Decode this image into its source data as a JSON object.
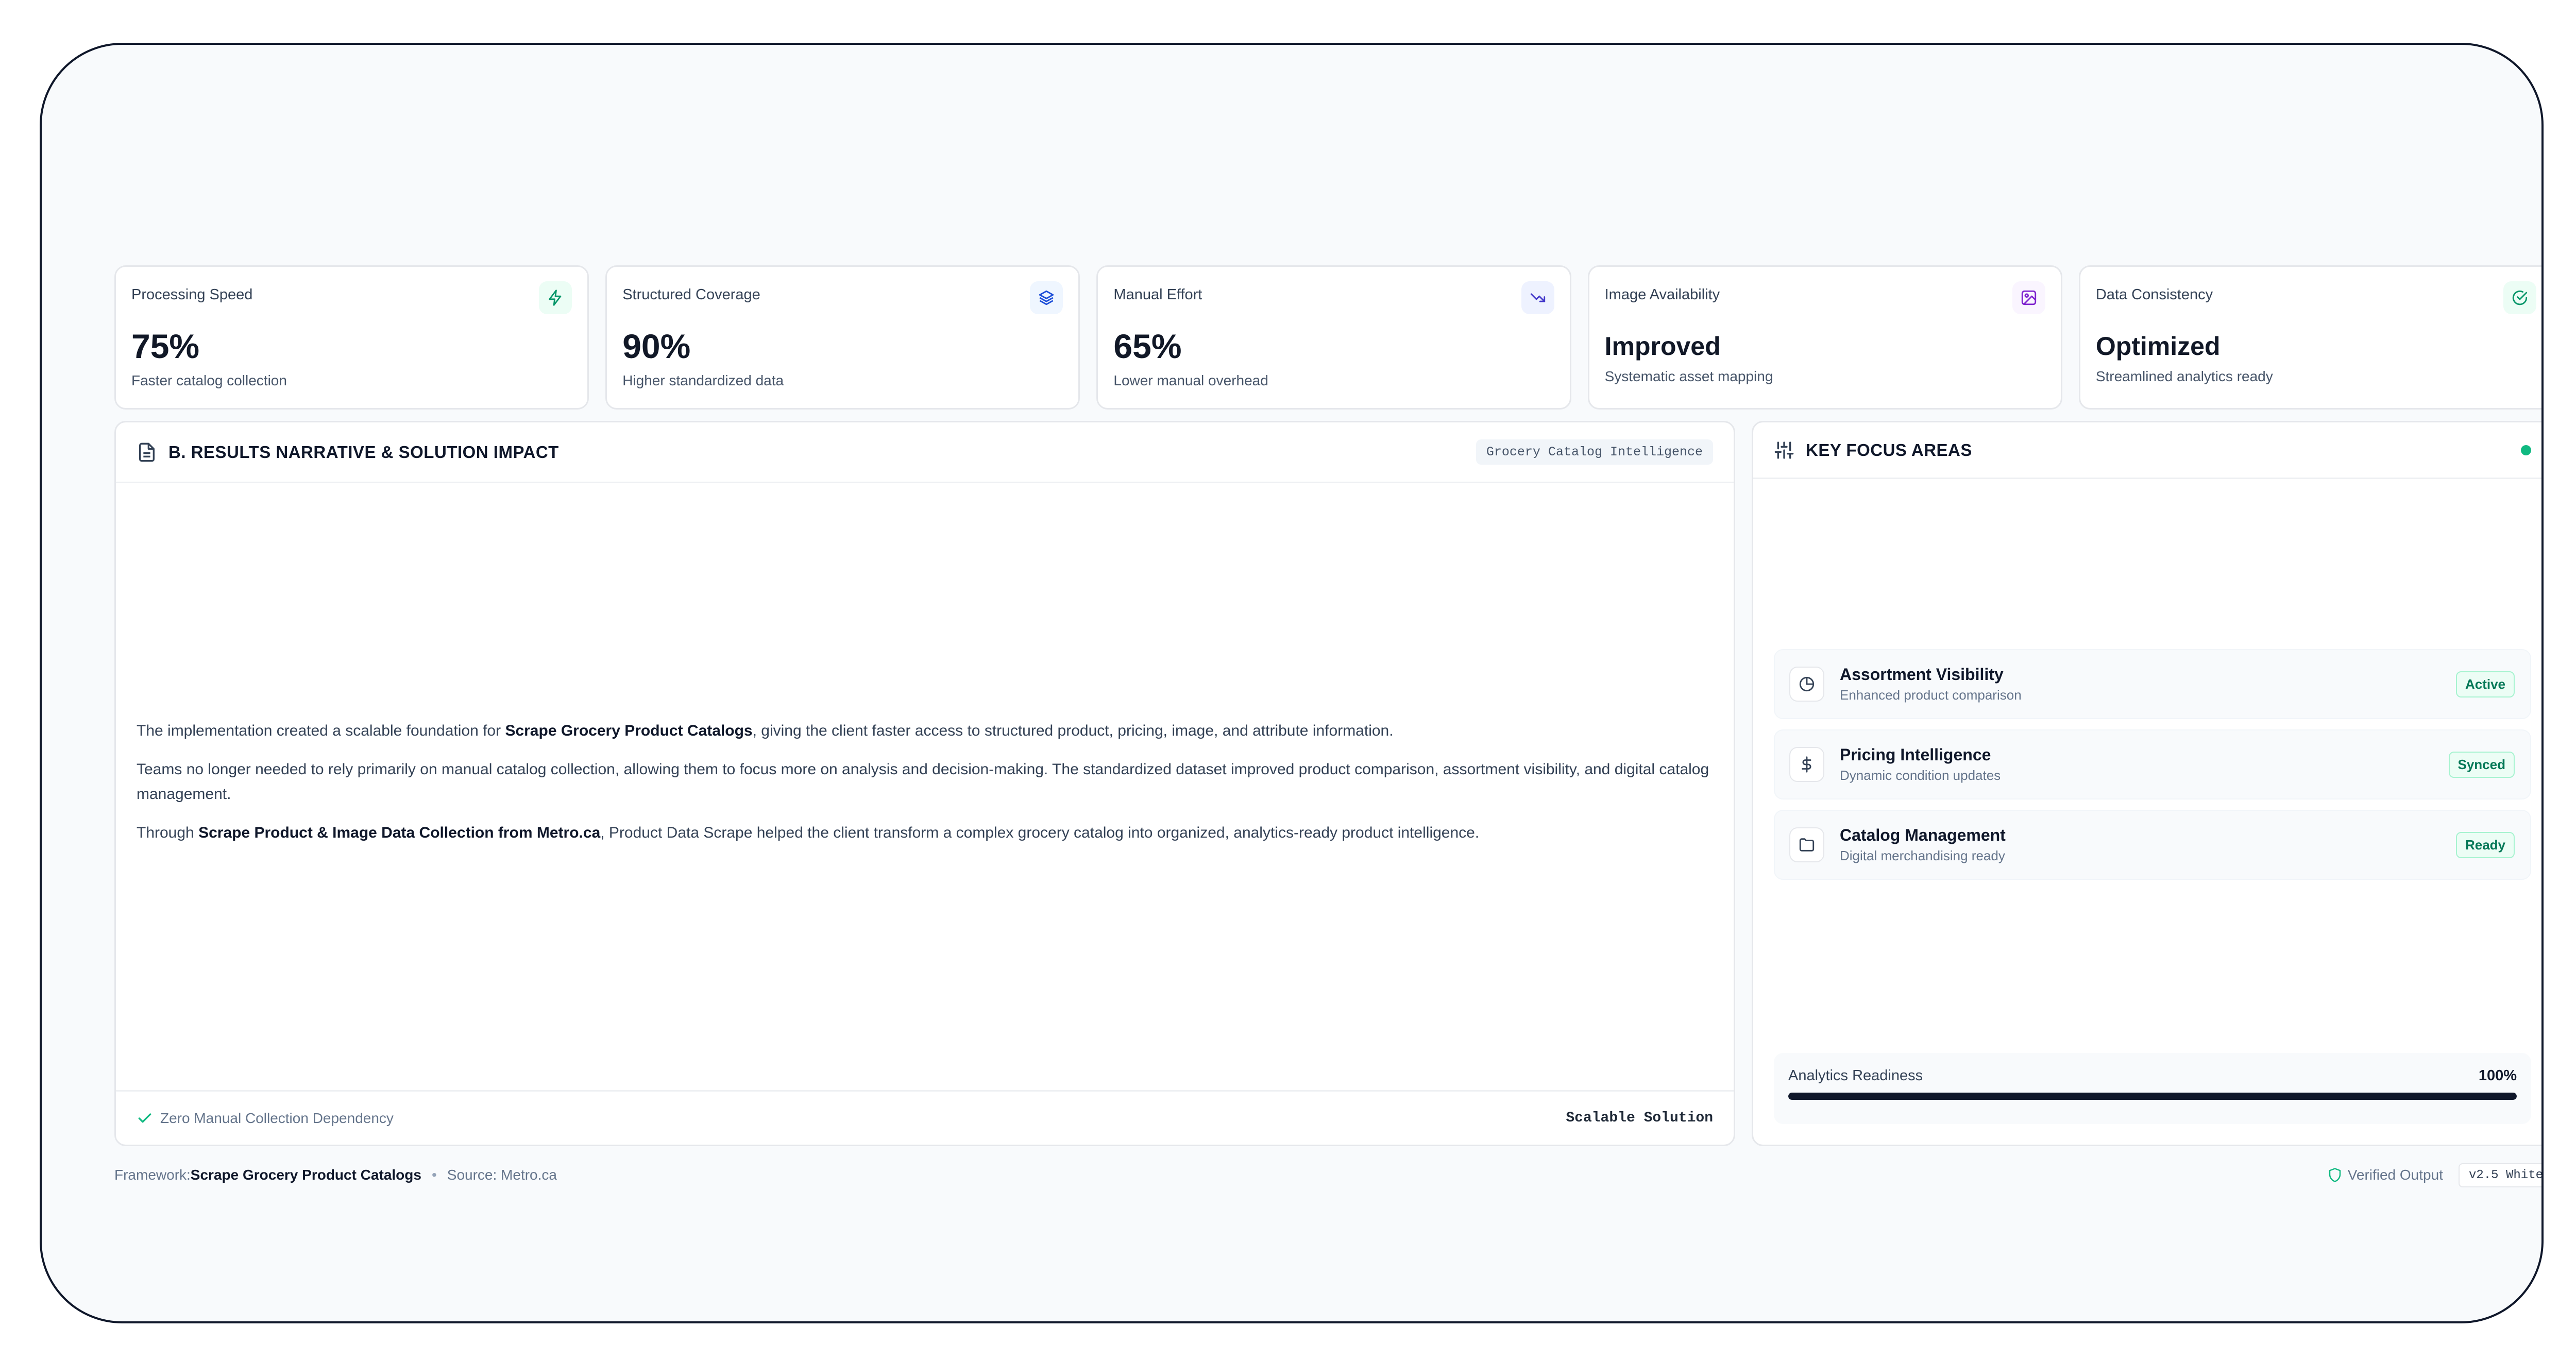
{
  "metrics": [
    {
      "label": "Processing Speed",
      "value": "75%",
      "sub": "Faster catalog collection",
      "icon": "zap-icon",
      "icon_color": "#059669",
      "icon_bg": "#ecfdf5"
    },
    {
      "label": "Structured Coverage",
      "value": "90%",
      "sub": "Higher standardized data",
      "icon": "layers-icon",
      "icon_color": "#1d4ed8",
      "icon_bg": "#eff6ff"
    },
    {
      "label": "Manual Effort",
      "value": "65%",
      "sub": "Lower manual overhead",
      "icon": "trending-down-icon",
      "icon_color": "#4338ca",
      "icon_bg": "#eef2ff"
    },
    {
      "label": "Image Availability",
      "value": "Improved",
      "sub": "Systematic asset mapping",
      "icon": "image-icon",
      "icon_color": "#7e22ce",
      "icon_bg": "#faf5ff"
    },
    {
      "label": "Data Consistency",
      "value": "Optimized",
      "sub": "Streamlined analytics ready",
      "icon": "check-circle-icon",
      "icon_color": "#059669",
      "icon_bg": "#ecfdf5"
    }
  ],
  "narrative": {
    "title": "B. RESULTS NARRATIVE & SOLUTION IMPACT",
    "tag": "Grocery Catalog Intelligence",
    "p1_pre": "The implementation created a scalable foundation for ",
    "p1_bold": "Scrape Grocery Product Catalogs",
    "p1_post": ", giving the client faster access to structured product, pricing, image, and attribute information.",
    "p2": "Teams no longer needed to rely primarily on manual catalog collection, allowing them to focus more on analysis and decision-making. The standardized dataset improved product comparison, assortment visibility, and digital catalog management.",
    "p3_pre": "Through ",
    "p3_bold": "Scrape Product & Image Data Collection from Metro.ca",
    "p3_post": ", Product Data Scrape helped the client transform a complex grocery catalog into organized, analytics-ready product intelligence.",
    "footer_left": "Zero Manual Collection Dependency",
    "footer_right": "Scalable Solution"
  },
  "focus": {
    "title": "KEY FOCUS AREAS",
    "items": [
      {
        "title": "Assortment Visibility",
        "sub": "Enhanced product comparison",
        "badge": "Active",
        "icon": "pie-chart-icon"
      },
      {
        "title": "Pricing Intelligence",
        "sub": "Dynamic condition updates",
        "badge": "Synced",
        "icon": "dollar-icon"
      },
      {
        "title": "Catalog Management",
        "sub": "Digital merchandising ready",
        "badge": "Ready",
        "icon": "folder-icon"
      }
    ],
    "readiness_label": "Analytics Readiness",
    "readiness_value": "100%",
    "readiness_fraction": 1.0
  },
  "footer": {
    "framework_label": "Framework: ",
    "framework_value": "Scrape Grocery Product Catalogs",
    "source": "Source: Metro.ca",
    "verified": "Verified Output",
    "version": "v2.5 White"
  }
}
